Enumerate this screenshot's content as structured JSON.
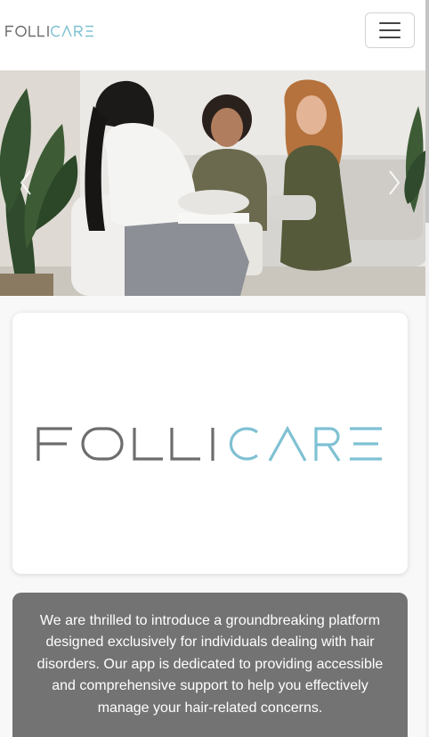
{
  "navbar": {
    "brand": {
      "part1": "FOLLI",
      "part2": "CARE"
    },
    "toggle_icon": "hamburger-menu-icon"
  },
  "hero": {
    "image": "therapy-session-photo",
    "prev_icon": "chevron-left-icon",
    "next_icon": "chevron-right-icon"
  },
  "logo_card": {
    "logo": {
      "part1": "FOLLI",
      "part2": "CARE"
    }
  },
  "intro": {
    "text": "We are thrilled to introduce a groundbreaking platform designed exclusively for individuals dealing with hair disorders. Our app is dedicated to providing accessible and comprehensive support to help you effectively manage your hair-related concerns."
  },
  "colors": {
    "logo_gray": "#6d6d6d",
    "logo_blue": "#7fc1d3",
    "intro_bg": "#737373"
  }
}
